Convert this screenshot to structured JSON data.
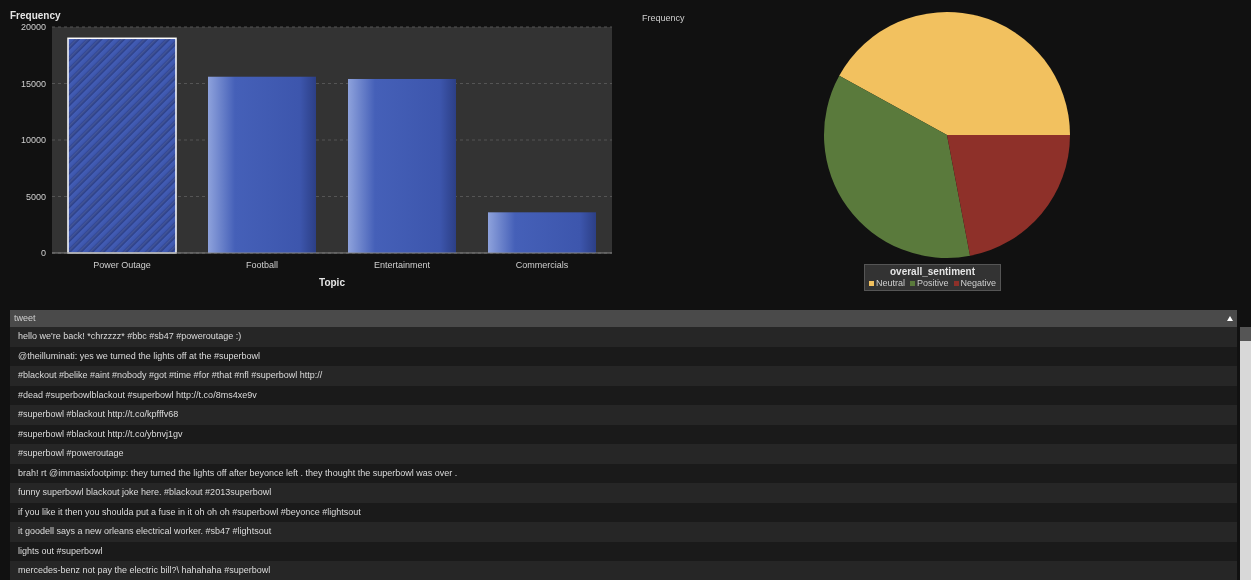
{
  "bar_panel": {
    "bar_selected": [
      true,
      false,
      false,
      false
    ],
    "chart_data": {
      "type": "bar",
      "ylabel": "Frequency",
      "xlabel": "Topic",
      "categories": [
        "Power Outage",
        "Football",
        "Entertainment",
        "Commercials"
      ],
      "values": [
        19000,
        15600,
        15400,
        3600
      ],
      "grid": true,
      "ylim": [
        0,
        20000
      ],
      "yticks": [
        0,
        5000,
        10000,
        15000,
        20000
      ]
    }
  },
  "pie_panel": {
    "title": "Frequency",
    "legend": {
      "title": "overall_sentiment",
      "items": [
        {
          "label": "Neutral",
          "color": "#f2c15f"
        },
        {
          "label": "Positive",
          "color": "#5a7a3c"
        },
        {
          "label": "Negative",
          "color": "#8e3029"
        }
      ]
    }
  },
  "table": {
    "columns": [
      {
        "label": "tweet",
        "sorted_ascending": true
      }
    ],
    "rows": [
      "hello  we're back! *chrzzzz* #bbc #sb47 #poweroutage :)",
      "@theilluminati: yes we turned the lights off at the #superbowl",
      "#blackout #belike #aint #nobody #got #time #for #that #nfl #superbowl http://",
      "#dead #superbowlblackout #superbowl http://t.co/8ms4xe9v",
      "#superbowl #blackout http://t.co/kpfffv68",
      "#superbowl #blackout http://t.co/ybnvj1gv",
      "#superbowl #poweroutage",
      "brah! rt @immasixfootpimp: they turned the lights off after beyonce left . they thought the superbowl was over .",
      "funny superbowl blackout joke here. #blackout #2013superbowl",
      "if you like it then you shoulda put a fuse in it oh oh oh #superbowl #beyonce #lightsout",
      "it goodell says a new orleans electrical worker. #sb47 #lightsout",
      "lights out #superbowl",
      "mercedes-benz not pay the electric bill?\\ hahahaha #superbowl"
    ]
  }
}
